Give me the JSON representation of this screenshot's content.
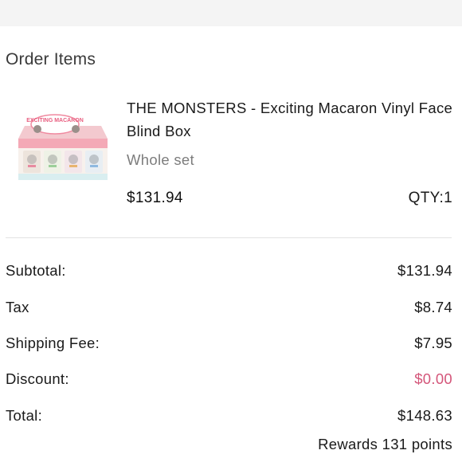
{
  "section_title": "Order Items",
  "item": {
    "name": "THE MONSTERS - Exciting Macaron Vinyl Face Blind Box",
    "variant": "Whole set",
    "price": "$131.94",
    "qty": "QTY:1",
    "image_icon": "product-box-image",
    "box_logo_text": "EXCITING MACARON"
  },
  "summary": {
    "subtotal_label": "Subtotal:",
    "subtotal_value": "$131.94",
    "tax_label": "Tax",
    "tax_value": "$8.74",
    "shipping_label": "Shipping Fee:",
    "shipping_value": "$7.95",
    "discount_label": "Discount:",
    "discount_value": "$0.00",
    "total_label": "Total:",
    "total_value": "$148.63",
    "rewards": "Rewards 131 points"
  },
  "colors": {
    "discount": "#d4567a",
    "divider": "#e2e2e2",
    "top_bar": "#f4f4f4"
  }
}
